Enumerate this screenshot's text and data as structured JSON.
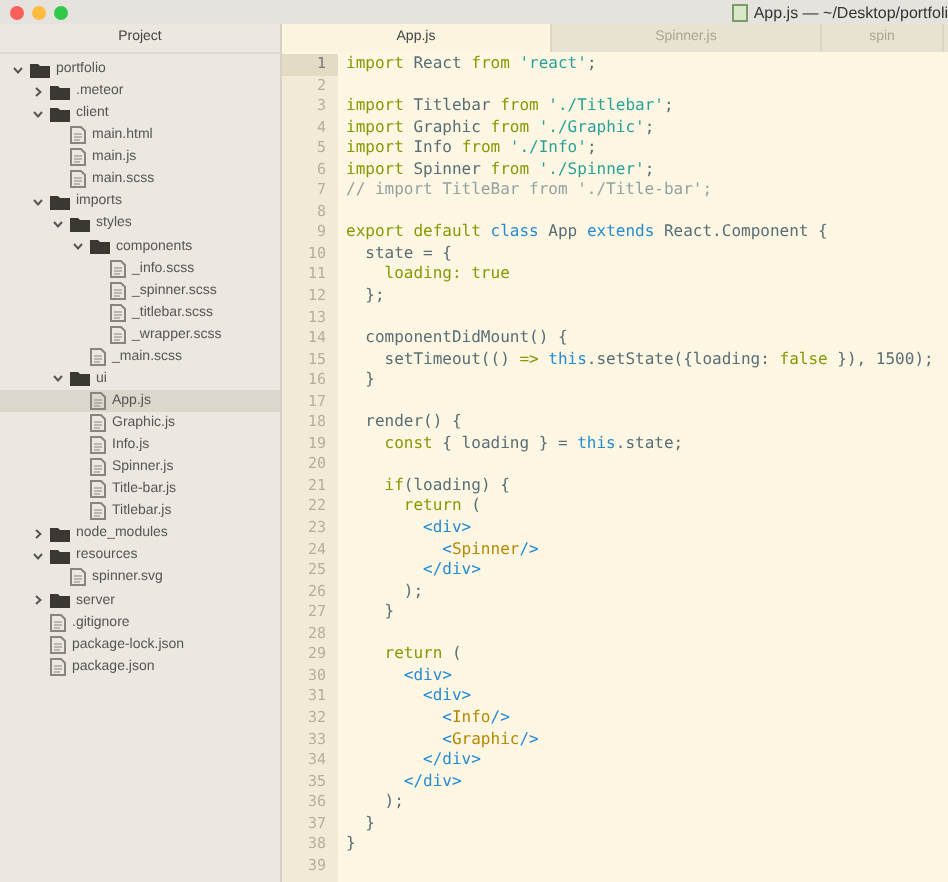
{
  "window": {
    "title": "App.js — ~/Desktop/portfoli"
  },
  "sidebar": {
    "title": "Project",
    "tree": [
      {
        "label": "portfolio",
        "kind": "folder",
        "expanded": true,
        "selected": false,
        "children": [
          {
            "label": ".meteor",
            "kind": "folder",
            "expanded": false,
            "selected": false
          },
          {
            "label": "client",
            "kind": "folder",
            "expanded": true,
            "selected": false,
            "children": [
              {
                "label": "main.html",
                "kind": "file",
                "selected": false
              },
              {
                "label": "main.js",
                "kind": "file",
                "selected": false
              },
              {
                "label": "main.scss",
                "kind": "file",
                "selected": false
              }
            ]
          },
          {
            "label": "imports",
            "kind": "folder",
            "expanded": true,
            "selected": false,
            "children": [
              {
                "label": "styles",
                "kind": "folder",
                "expanded": true,
                "selected": false,
                "children": [
                  {
                    "label": "components",
                    "kind": "folder",
                    "expanded": true,
                    "selected": false,
                    "children": [
                      {
                        "label": "_info.scss",
                        "kind": "file",
                        "selected": false
                      },
                      {
                        "label": "_spinner.scss",
                        "kind": "file",
                        "selected": false
                      },
                      {
                        "label": "_titlebar.scss",
                        "kind": "file",
                        "selected": false
                      },
                      {
                        "label": "_wrapper.scss",
                        "kind": "file",
                        "selected": false
                      }
                    ]
                  },
                  {
                    "label": "_main.scss",
                    "kind": "file",
                    "selected": false
                  }
                ]
              },
              {
                "label": "ui",
                "kind": "folder",
                "expanded": true,
                "selected": false,
                "children": [
                  {
                    "label": "App.js",
                    "kind": "file",
                    "selected": true
                  },
                  {
                    "label": "Graphic.js",
                    "kind": "file",
                    "selected": false
                  },
                  {
                    "label": "Info.js",
                    "kind": "file",
                    "selected": false
                  },
                  {
                    "label": "Spinner.js",
                    "kind": "file",
                    "selected": false
                  },
                  {
                    "label": "Title-bar.js",
                    "kind": "file",
                    "selected": false
                  },
                  {
                    "label": "Titlebar.js",
                    "kind": "file",
                    "selected": false
                  }
                ]
              }
            ]
          },
          {
            "label": "node_modules",
            "kind": "folder",
            "expanded": false,
            "selected": false
          },
          {
            "label": "resources",
            "kind": "folder",
            "expanded": true,
            "selected": false,
            "children": [
              {
                "label": "spinner.svg",
                "kind": "file",
                "selected": false
              }
            ]
          },
          {
            "label": "server",
            "kind": "folder",
            "expanded": false,
            "selected": false
          },
          {
            "label": ".gitignore",
            "kind": "file",
            "selected": false
          },
          {
            "label": "package-lock.json",
            "kind": "file",
            "selected": false
          },
          {
            "label": "package.json",
            "kind": "file",
            "selected": false
          }
        ]
      }
    ]
  },
  "tabs": [
    {
      "label": "App.js",
      "selected": true
    },
    {
      "label": "Spinner.js",
      "selected": false
    },
    {
      "label": "spin",
      "selected": false
    }
  ],
  "editor": {
    "lines": [
      {
        "n": "1",
        "current": true,
        "tokens": [
          {
            "t": "import",
            "color": "#859900"
          },
          {
            "t": " React ",
            "color": "#586e75"
          },
          {
            "t": "from ",
            "color": "#859900"
          },
          {
            "t": "'react'",
            "color": "#2aa198"
          },
          {
            "t": ";",
            "color": "#586e75"
          }
        ]
      },
      {
        "n": "2",
        "current": false
      },
      {
        "n": "3",
        "current": false,
        "tokens": [
          {
            "t": "import",
            "color": "#859900"
          },
          {
            "t": " Titlebar ",
            "color": "#586e75"
          },
          {
            "t": "from ",
            "color": "#859900"
          },
          {
            "t": "'./Titlebar'",
            "color": "#2aa198"
          },
          {
            "t": ";",
            "color": "#586e75"
          }
        ]
      },
      {
        "n": "4",
        "current": false,
        "tokens": [
          {
            "t": "import",
            "color": "#859900"
          },
          {
            "t": " Graphic ",
            "color": "#586e75"
          },
          {
            "t": "from ",
            "color": "#859900"
          },
          {
            "t": "'./Graphic'",
            "color": "#2aa198"
          },
          {
            "t": ";",
            "color": "#586e75"
          }
        ]
      },
      {
        "n": "5",
        "current": false,
        "tokens": [
          {
            "t": "import",
            "color": "#859900"
          },
          {
            "t": " Info ",
            "color": "#586e75"
          },
          {
            "t": "from ",
            "color": "#859900"
          },
          {
            "t": "'./Info'",
            "color": "#2aa198"
          },
          {
            "t": ";",
            "color": "#586e75"
          }
        ]
      },
      {
        "n": "6",
        "current": false,
        "tokens": [
          {
            "t": "import",
            "color": "#859900"
          },
          {
            "t": " Spinner ",
            "color": "#586e75"
          },
          {
            "t": "from ",
            "color": "#859900"
          },
          {
            "t": "'./Spinner'",
            "color": "#2aa198"
          },
          {
            "t": ";",
            "color": "#586e75"
          }
        ]
      },
      {
        "n": "7",
        "current": false,
        "tokens": [
          {
            "t": "// import TitleBar from './Title-bar';",
            "color": "#93a1a1"
          }
        ]
      },
      {
        "n": "8",
        "current": false
      },
      {
        "n": "9",
        "current": false,
        "tokens": [
          {
            "t": "export default ",
            "color": "#859900"
          },
          {
            "t": "class",
            "color": "#268bd2"
          },
          {
            "t": " App ",
            "color": "#586e75"
          },
          {
            "t": "extends",
            "color": "#268bd2"
          },
          {
            "t": " React.Component {",
            "color": "#586e75"
          }
        ]
      },
      {
        "n": "10",
        "current": false,
        "tokens": [
          {
            "t": "  state = {",
            "color": "#586e75"
          }
        ]
      },
      {
        "n": "11",
        "current": false,
        "tokens": [
          {
            "t": "    loading: true",
            "color": "#859900"
          }
        ]
      },
      {
        "n": "12",
        "current": false,
        "tokens": [
          {
            "t": "  };",
            "color": "#586e75"
          }
        ]
      },
      {
        "n": "13",
        "current": false
      },
      {
        "n": "14",
        "current": false,
        "tokens": [
          {
            "t": "  componentDidMount() {",
            "color": "#586e75"
          }
        ]
      },
      {
        "n": "15",
        "current": false,
        "tokens": [
          {
            "t": "    setTimeout(() ",
            "color": "#586e75"
          },
          {
            "t": "=> ",
            "color": "#859900"
          },
          {
            "t": "this",
            "color": "#268bd2"
          },
          {
            "t": ".setState({loading: ",
            "color": "#586e75"
          },
          {
            "t": "false",
            "color": "#859900"
          },
          {
            "t": " }), 1500);",
            "color": "#586e75"
          }
        ]
      },
      {
        "n": "16",
        "current": false,
        "tokens": [
          {
            "t": "  }",
            "color": "#586e75"
          }
        ]
      },
      {
        "n": "17",
        "current": false
      },
      {
        "n": "18",
        "current": false,
        "tokens": [
          {
            "t": "  render() {",
            "color": "#586e75"
          }
        ]
      },
      {
        "n": "19",
        "current": false,
        "tokens": [
          {
            "t": "    const",
            "color": "#859900"
          },
          {
            "t": " { loading } = ",
            "color": "#586e75"
          },
          {
            "t": "this",
            "color": "#268bd2"
          },
          {
            "t": ".state;",
            "color": "#586e75"
          }
        ]
      },
      {
        "n": "20",
        "current": false
      },
      {
        "n": "21",
        "current": false,
        "tokens": [
          {
            "t": "    if",
            "color": "#859900"
          },
          {
            "t": "(loading) {",
            "color": "#586e75"
          }
        ]
      },
      {
        "n": "22",
        "current": false,
        "tokens": [
          {
            "t": "      return",
            "color": "#859900"
          },
          {
            "t": " (",
            "color": "#586e75"
          }
        ]
      },
      {
        "n": "23",
        "current": false,
        "tokens": [
          {
            "t": "        <div>",
            "color": "#268bd2"
          }
        ]
      },
      {
        "n": "24",
        "current": false,
        "tokens": [
          {
            "t": "          <",
            "color": "#268bd2"
          },
          {
            "t": "Spinner",
            "color": "#b58900"
          },
          {
            "t": "/>",
            "color": "#268bd2"
          }
        ]
      },
      {
        "n": "25",
        "current": false,
        "tokens": [
          {
            "t": "        </div>",
            "color": "#268bd2"
          }
        ]
      },
      {
        "n": "26",
        "current": false,
        "tokens": [
          {
            "t": "      );",
            "color": "#586e75"
          }
        ]
      },
      {
        "n": "27",
        "current": false,
        "tokens": [
          {
            "t": "    }",
            "color": "#586e75"
          }
        ]
      },
      {
        "n": "28",
        "current": false
      },
      {
        "n": "29",
        "current": false,
        "tokens": [
          {
            "t": "    return",
            "color": "#859900"
          },
          {
            "t": " (",
            "color": "#586e75"
          }
        ]
      },
      {
        "n": "30",
        "current": false,
        "tokens": [
          {
            "t": "      <div>",
            "color": "#268bd2"
          }
        ]
      },
      {
        "n": "31",
        "current": false,
        "tokens": [
          {
            "t": "        <div>",
            "color": "#268bd2"
          }
        ]
      },
      {
        "n": "32",
        "current": false,
        "tokens": [
          {
            "t": "          <",
            "color": "#268bd2"
          },
          {
            "t": "Info",
            "color": "#b58900"
          },
          {
            "t": "/>",
            "color": "#268bd2"
          }
        ]
      },
      {
        "n": "33",
        "current": false,
        "tokens": [
          {
            "t": "          <",
            "color": "#268bd2"
          },
          {
            "t": "Graphic",
            "color": "#b58900"
          },
          {
            "t": "/>",
            "color": "#268bd2"
          }
        ]
      },
      {
        "n": "34",
        "current": false,
        "tokens": [
          {
            "t": "        </div>",
            "color": "#268bd2"
          }
        ]
      },
      {
        "n": "35",
        "current": false,
        "tokens": [
          {
            "t": "      </div>",
            "color": "#268bd2"
          }
        ]
      },
      {
        "n": "36",
        "current": false,
        "tokens": [
          {
            "t": "    );",
            "color": "#586e75"
          }
        ]
      },
      {
        "n": "37",
        "current": false,
        "tokens": [
          {
            "t": "  }",
            "color": "#586e75"
          }
        ]
      },
      {
        "n": "38",
        "current": false,
        "tokens": [
          {
            "t": "}",
            "color": "#586e75"
          }
        ]
      },
      {
        "n": "39",
        "current": false
      }
    ]
  }
}
